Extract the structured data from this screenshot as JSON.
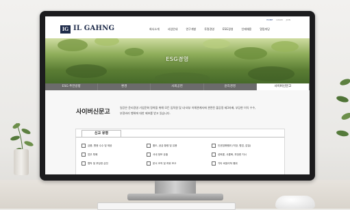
{
  "header": {
    "logo_mark": "IG",
    "logo_text": "IL GAHNG",
    "util_links": [
      "HOME",
      "LOGIN",
      "JOIN"
    ],
    "nav": [
      "회사소개",
      "사업안내",
      "연구개발",
      "투명경영",
      "ESG경영",
      "인재채용",
      "알림마당"
    ]
  },
  "hero": {
    "title": "ESG경영"
  },
  "tabs": [
    {
      "label": "ESG 추진방향",
      "active": false
    },
    {
      "label": "환경",
      "active": false
    },
    {
      "label": "사회공헌",
      "active": false
    },
    {
      "label": "윤리경영",
      "active": false
    },
    {
      "label": "사이버신문고",
      "active": true
    }
  ],
  "content": {
    "title": "사이버신문고",
    "description": "일강은 윤리경영 기업문화 정착을 위해 모든 임직원 및 내·외부 이해관계자에 관련된 불공정 제3자배, 부당한 이익 수수, 부정비리 행위에 대한 제보를 받고 있습니다.",
    "report_tab": "신고 유형",
    "report_types": [
      "금품, 향응 수수 및 제공",
      "횡도, 공금 횡령 및 유용",
      "인권침해행위 (직장, 협업, 갑질)",
      "업무 특혜",
      "사내 정보 유출",
      "성희롱, 사롱화, 부당한 지시",
      "협박 및 부당한 금전",
      "문서 조작 및 허위 보고",
      "기타 비윤리적 행위"
    ]
  },
  "colors": {
    "brand_navy": "#1e2b4a",
    "tab_bar": "#6b6b6b",
    "hero_green": "#5b7d34"
  }
}
